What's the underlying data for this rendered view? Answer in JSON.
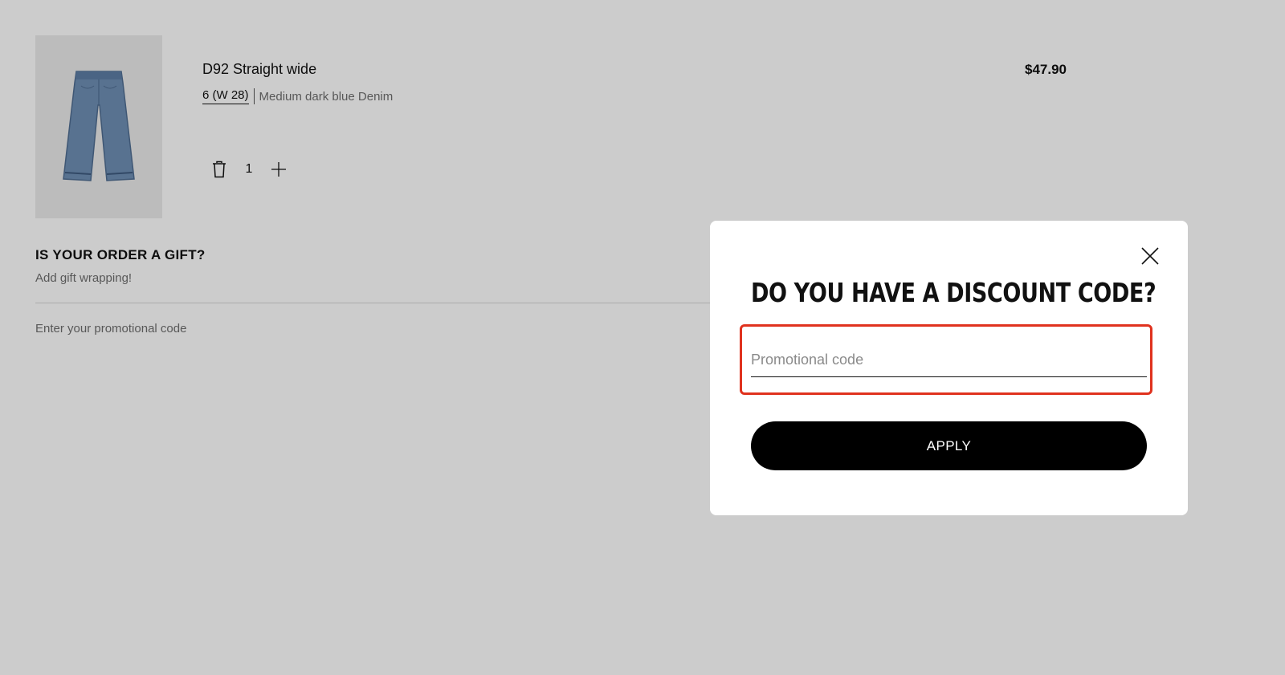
{
  "cart": {
    "item": {
      "image_icon": "jeans-icon",
      "name": "D92 Straight wide",
      "size": "6 (W 28)",
      "color": "Medium dark blue Denim",
      "price": "$47.90",
      "quantity": "1"
    },
    "gift": {
      "title": "IS YOUR ORDER A GIFT?",
      "subtitle": "Add gift wrapping!"
    },
    "promo_link": "Enter your promotional code"
  },
  "modal": {
    "title": "DO YOU HAVE A DISCOUNT CODE?",
    "input_placeholder": "Promotional code",
    "input_value": "",
    "apply_label": "APPLY",
    "highlight_color": "#e0321e"
  }
}
